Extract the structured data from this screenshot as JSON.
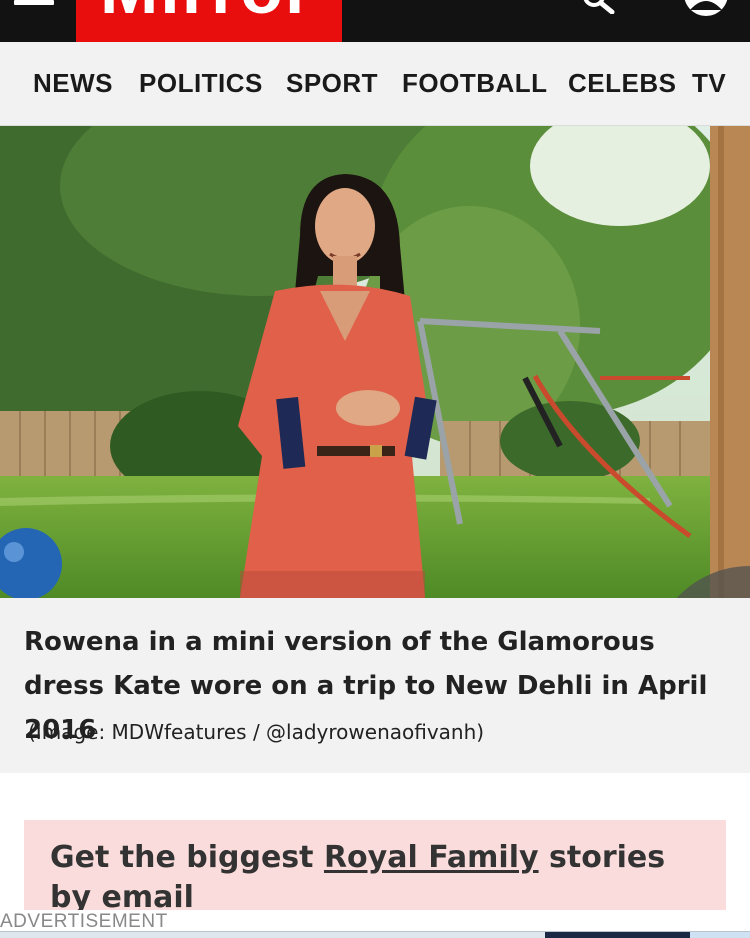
{
  "header": {
    "logo_text": "Mirror",
    "menu_icon": "hamburger-icon",
    "search_icon": "search-icon",
    "account_icon": "account-icon",
    "brand_color": "#e90e0e"
  },
  "nav": {
    "items": [
      "NEWS",
      "POLITICS",
      "SPORT",
      "FOOTBALL",
      "CELEBS",
      "TV"
    ]
  },
  "gallery": {
    "next_icon": "chevron-right-icon",
    "caption": "Rowena in a mini version of the Glamorous dress Kate wore on a trip to New Dehli in April 2016",
    "credit": "(Image: MDWfeatures / @ladyrowenaofivanh)"
  },
  "newsletter": {
    "prefix": "Get the biggest ",
    "link": "Royal Family",
    "suffix": " stories by email"
  },
  "ad": {
    "label": "ADVERTISEMENT"
  }
}
